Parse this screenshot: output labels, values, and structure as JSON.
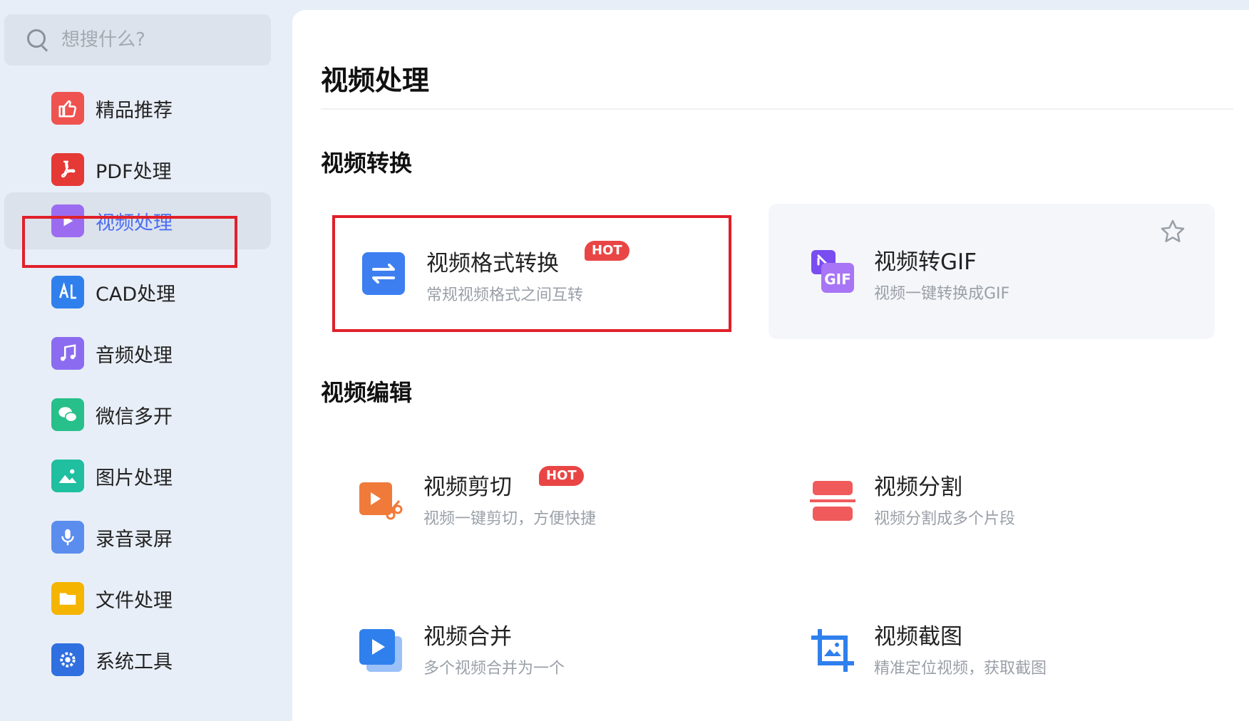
{
  "search": {
    "placeholder": "想搜什么?"
  },
  "sidebar": {
    "items": [
      {
        "label": "精品推荐",
        "icon": "thumbs-up-icon",
        "color": "#ef5350"
      },
      {
        "label": "PDF处理",
        "icon": "pdf-icon",
        "color": "#e53935"
      },
      {
        "label": "视频处理",
        "icon": "play-icon",
        "color": "#9c6cf0",
        "active": true
      },
      {
        "label": "CAD处理",
        "icon": "cad-icon",
        "color": "#2f80ed"
      },
      {
        "label": "音频处理",
        "icon": "music-note-icon",
        "color": "#8b6cf0"
      },
      {
        "label": "微信多开",
        "icon": "wechat-icon",
        "color": "#27c08a"
      },
      {
        "label": "图片处理",
        "icon": "image-icon",
        "color": "#1fbfa0"
      },
      {
        "label": "录音录屏",
        "icon": "microphone-icon",
        "color": "#5b8def"
      },
      {
        "label": "文件处理",
        "icon": "folder-icon",
        "color": "#f5b400"
      },
      {
        "label": "系统工具",
        "icon": "gear-icon",
        "color": "#2f6fe0"
      }
    ]
  },
  "main": {
    "title": "视频处理",
    "sections": [
      {
        "title": "视频转换",
        "tools": [
          {
            "title": "视频格式转换",
            "desc": "常规视频格式之间互转",
            "badge": "HOT",
            "icon": "swap-arrows-icon"
          },
          {
            "title": "视频转GIF",
            "desc": "视频一键转换成GIF",
            "icon": "gif-icon",
            "icon_text": "GIF"
          }
        ]
      },
      {
        "title": "视频编辑",
        "tools": [
          {
            "title": "视频剪切",
            "desc": "视频一键剪切，方便快捷",
            "badge": "HOT",
            "icon": "video-cut-icon"
          },
          {
            "title": "视频分割",
            "desc": "视频分割成多个片段",
            "icon": "split-icon"
          },
          {
            "title": "视频合并",
            "desc": "多个视频合并为一个",
            "icon": "video-merge-icon"
          },
          {
            "title": "视频截图",
            "desc": "精准定位视频，获取截图",
            "icon": "crop-screenshot-icon"
          }
        ]
      }
    ]
  },
  "colors": {
    "accent": "#4c6ef5",
    "hot": "#e94545",
    "highlight_frame": "#e0202a"
  }
}
